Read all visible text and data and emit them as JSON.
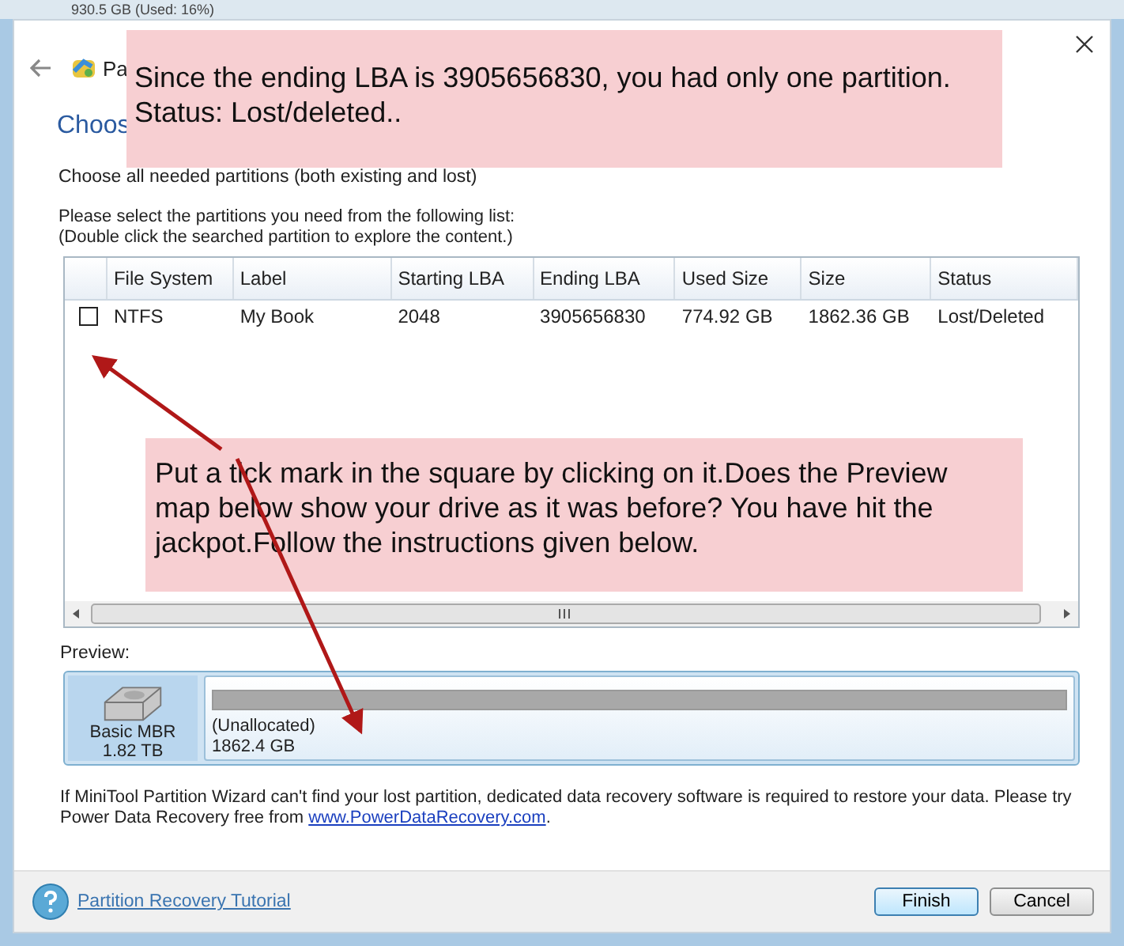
{
  "background": {
    "disk_info": "930.5 GB (Used: 16%)"
  },
  "dialog": {
    "title": "Pa",
    "heading": "Choos",
    "intro": "Choose all needed partitions (both existing and lost)",
    "instructions": [
      "Please select the partitions you need from the following list:",
      "(Double click the searched partition to explore the content.)"
    ]
  },
  "table": {
    "columns": [
      "File System",
      "Label",
      "Starting LBA",
      "Ending LBA",
      "Used Size",
      "Size",
      "Status"
    ],
    "rows": [
      {
        "checked": false,
        "cells": [
          "NTFS",
          "My Book",
          "2048",
          "3905656830",
          "774.92 GB",
          "1862.36 GB",
          "Lost/Deleted"
        ]
      }
    ]
  },
  "preview": {
    "label": "Preview:",
    "disk": {
      "type": "Basic MBR",
      "size": "1.82 TB"
    },
    "partitions": [
      {
        "label": "(Unallocated)",
        "size": "1862.4 GB"
      }
    ]
  },
  "note": {
    "text": "If MiniTool Partition Wizard can't find your lost partition, dedicated data recovery software is required to restore your data. Please try Power Data Recovery free from ",
    "link": "www.PowerDataRecovery.com",
    "end": "."
  },
  "footer": {
    "help_link": "Partition Recovery Tutorial",
    "buttons": [
      {
        "label": "Finish",
        "selected": true
      },
      {
        "label": "Cancel",
        "selected": false
      }
    ]
  },
  "annotations": [
    "Since the ending LBA is 3905656830, you had only one partition. Status: Lost/deleted..",
    "Put a tick mark in the square by clicking on it.Does the Preview map below show your drive as it was before? You have hit the jackpot.Follow the instructions given below."
  ]
}
